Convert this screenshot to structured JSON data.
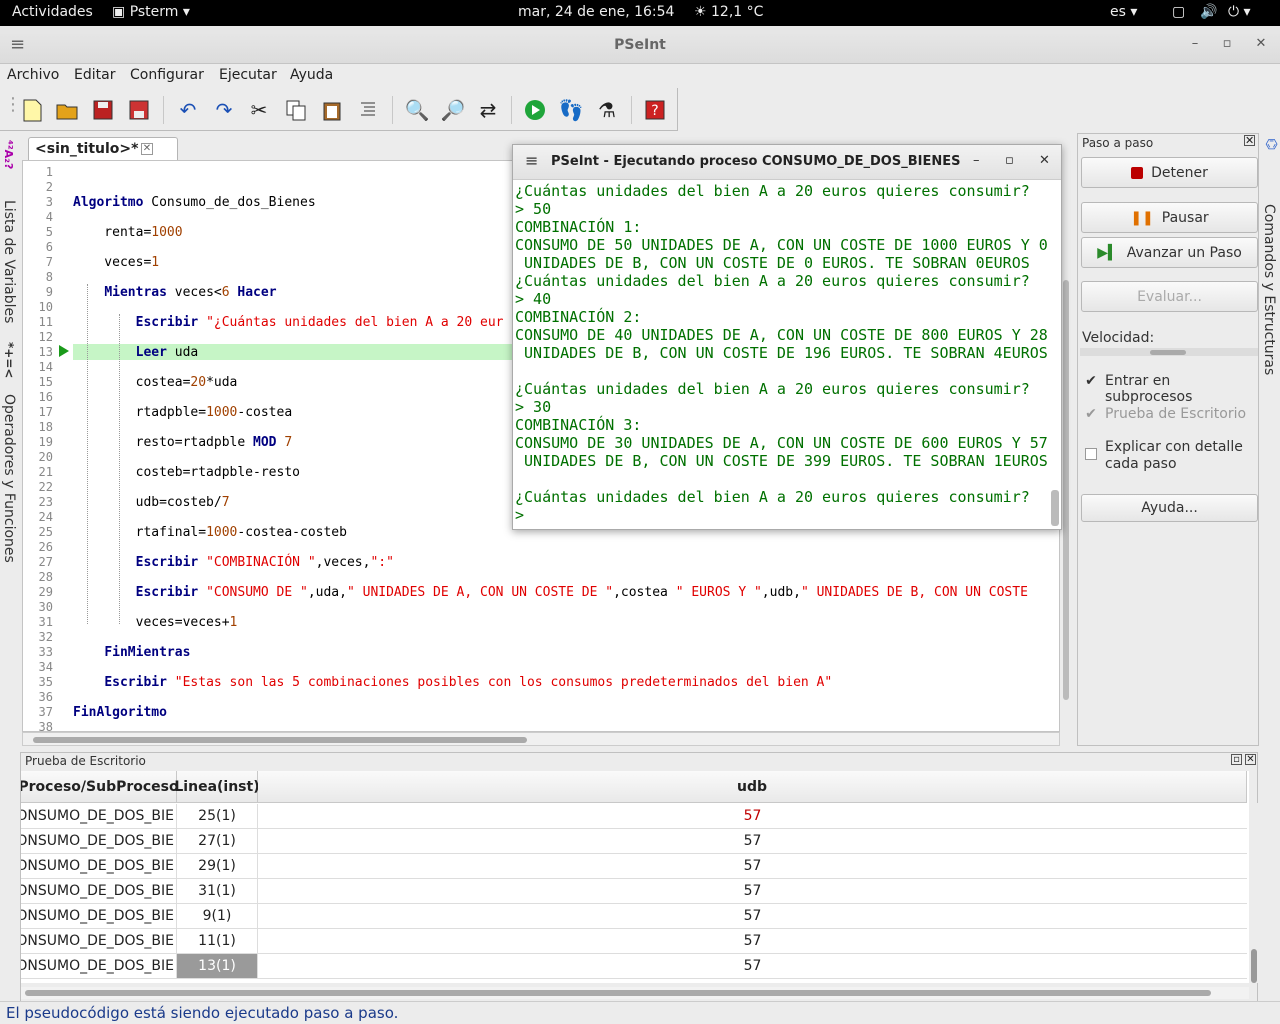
{
  "topbar": {
    "activities": "Actividades",
    "app": "Psterm ▾",
    "datetime": "mar, 24 de ene, 16:54",
    "weather": "☀ 12,1 °C",
    "lang": "es ▾"
  },
  "window": {
    "title": "PSeInt",
    "minimize": "–",
    "maximize": "▫",
    "close": "✕",
    "menu_icon": "≡"
  },
  "menu": [
    "Archivo",
    "Editar",
    "Configurar",
    "Ejecutar",
    "Ayuda"
  ],
  "left_tabs": {
    "variables": "Lista de Variables",
    "operators": "Operadores y Funciones",
    "var_icon": "⁴²A₂?",
    "op_icon": "*+=<"
  },
  "right_tabs": {
    "commands": "Comandos y Estructuras"
  },
  "editor": {
    "tab_label": "<sin_titulo>*",
    "tab_close": "✕",
    "lines": [
      {
        "n": "1",
        "code": ""
      },
      {
        "n": "2",
        "code": ""
      },
      {
        "n": "3",
        "code": "Algoritmo Consumo_de_dos_Bienes"
      },
      {
        "n": "4",
        "code": ""
      },
      {
        "n": "5",
        "code": "    renta=1000"
      },
      {
        "n": "6",
        "code": ""
      },
      {
        "n": "7",
        "code": "    veces=1"
      },
      {
        "n": "8",
        "code": ""
      },
      {
        "n": "9",
        "code": "    Mientras veces<6 Hacer"
      },
      {
        "n": "10",
        "code": ""
      },
      {
        "n": "11",
        "code": "        Escribir \"¿Cuántas unidades del bien A a 20 eur"
      },
      {
        "n": "12",
        "code": ""
      },
      {
        "n": "13",
        "code": "        Leer uda"
      },
      {
        "n": "14",
        "code": ""
      },
      {
        "n": "15",
        "code": "        costea=20*uda"
      },
      {
        "n": "16",
        "code": ""
      },
      {
        "n": "17",
        "code": "        rtadpble=1000-costea"
      },
      {
        "n": "18",
        "code": ""
      },
      {
        "n": "19",
        "code": "        resto=rtadpble MOD 7"
      },
      {
        "n": "20",
        "code": ""
      },
      {
        "n": "21",
        "code": "        costeb=rtadpble-resto"
      },
      {
        "n": "22",
        "code": ""
      },
      {
        "n": "23",
        "code": "        udb=costeb/7"
      },
      {
        "n": "24",
        "code": ""
      },
      {
        "n": "25",
        "code": "        rtafinal=1000-costea-costeb"
      },
      {
        "n": "26",
        "code": ""
      },
      {
        "n": "27",
        "code": "        Escribir \"COMBINACIÓN \",veces,\":\""
      },
      {
        "n": "28",
        "code": ""
      },
      {
        "n": "29",
        "code": "        Escribir \"CONSUMO DE \",uda,\" UNIDADES DE A, CON UN COSTE DE \",costea \" EUROS Y \",udb,\" UNIDADES DE B, CON UN COSTE"
      },
      {
        "n": "30",
        "code": ""
      },
      {
        "n": "31",
        "code": "        veces=veces+1"
      },
      {
        "n": "32",
        "code": ""
      },
      {
        "n": "33",
        "code": "    FinMientras"
      },
      {
        "n": "34",
        "code": ""
      },
      {
        "n": "35",
        "code": "    Escribir \"Estas son las 5 combinaciones posibles con los consumos predeterminados del bien A\""
      },
      {
        "n": "36",
        "code": ""
      },
      {
        "n": "37",
        "code": "FinAlgoritmo"
      },
      {
        "n": "38",
        "code": ""
      }
    ]
  },
  "dialog": {
    "title": "PSeInt - Ejecutando proceso CONSUMO_DE_DOS_BIENES",
    "menu_icon": "≡",
    "minimize": "–",
    "maximize": "▫",
    "close": "✕",
    "console": "¿Cuántas unidades del bien A a 20 euros quieres consumir?\n> 50\nCOMBINACIÓN 1:\nCONSUMO DE 50 UNIDADES DE A, CON UN COSTE DE 1000 EUROS Y 0\n UNIDADES DE B, CON UN COSTE DE 0 EUROS. TE SOBRAN 0EUROS\n¿Cuántas unidades del bien A a 20 euros quieres consumir?\n> 40\nCOMBINACIÓN 2:\nCONSUMO DE 40 UNIDADES DE A, CON UN COSTE DE 800 EUROS Y 28\n UNIDADES DE B, CON UN COSTE DE 196 EUROS. TE SOBRAN 4EUROS\n\n¿Cuántas unidades del bien A a 20 euros quieres consumir?\n> 30\nCOMBINACIÓN 3:\nCONSUMO DE 30 UNIDADES DE A, CON UN COSTE DE 600 EUROS Y 57\n UNIDADES DE B, CON UN COSTE DE 399 EUROS. TE SOBRAN 1EUROS\n\n¿Cuántas unidades del bien A a 20 euros quieres consumir?\n>"
  },
  "step_panel": {
    "header": "Paso a paso",
    "stop": "Detener",
    "pause": "Pausar",
    "step": "Avanzar un Paso",
    "evaluate": "Evaluar...",
    "speed": "Velocidad:",
    "enter_sub": "Entrar en subprocesos",
    "desk_test": "Prueba de Escritorio",
    "explain": "Explicar con detalle cada paso",
    "help": "Ayuda..."
  },
  "desk_panel": {
    "header": "Prueba de Escritorio",
    "columns": [
      "Proceso/SubProceso",
      "Linea(inst)",
      "udb"
    ],
    "rows": [
      {
        "proc": "CONSUMO_DE_DOS_BIE",
        "line": "25(1)",
        "udb": "57",
        "changed": true
      },
      {
        "proc": "CONSUMO_DE_DOS_BIE",
        "line": "27(1)",
        "udb": "57",
        "changed": false
      },
      {
        "proc": "CONSUMO_DE_DOS_BIE",
        "line": "29(1)",
        "udb": "57",
        "changed": false
      },
      {
        "proc": "CONSUMO_DE_DOS_BIE",
        "line": "31(1)",
        "udb": "57",
        "changed": false
      },
      {
        "proc": "CONSUMO_DE_DOS_BIE",
        "line": "9(1)",
        "udb": "57",
        "changed": false
      },
      {
        "proc": "CONSUMO_DE_DOS_BIE",
        "line": "11(1)",
        "udb": "57",
        "changed": false
      },
      {
        "proc": "CONSUMO_DE_DOS_BIE",
        "line": "13(1)",
        "udb": "57",
        "changed": false,
        "current": true
      }
    ]
  },
  "status": "El pseudocódigo está siendo ejecutado paso a paso.",
  "colors": {
    "keyword": "#000080",
    "string": "#e00000",
    "number": "#a04000",
    "console": "#007000",
    "highlight": "#c6f5c6"
  }
}
